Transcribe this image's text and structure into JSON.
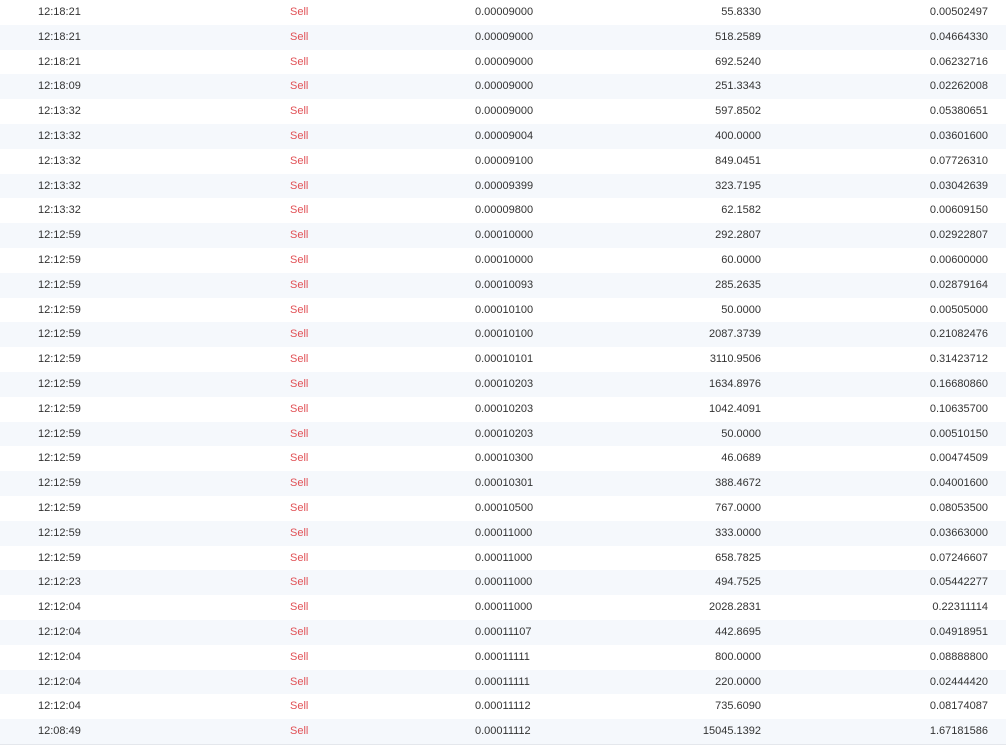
{
  "colors": {
    "sell": "#e15156",
    "text": "#333333",
    "row_alt_background": "#f5f8fc"
  },
  "trades": [
    {
      "time": "12:18:21",
      "side": "Sell",
      "price": "0.00009000",
      "amount": "55.8330",
      "total": "0.00502497"
    },
    {
      "time": "12:18:21",
      "side": "Sell",
      "price": "0.00009000",
      "amount": "518.2589",
      "total": "0.04664330"
    },
    {
      "time": "12:18:21",
      "side": "Sell",
      "price": "0.00009000",
      "amount": "692.5240",
      "total": "0.06232716"
    },
    {
      "time": "12:18:09",
      "side": "Sell",
      "price": "0.00009000",
      "amount": "251.3343",
      "total": "0.02262008"
    },
    {
      "time": "12:13:32",
      "side": "Sell",
      "price": "0.00009000",
      "amount": "597.8502",
      "total": "0.05380651"
    },
    {
      "time": "12:13:32",
      "side": "Sell",
      "price": "0.00009004",
      "amount": "400.0000",
      "total": "0.03601600"
    },
    {
      "time": "12:13:32",
      "side": "Sell",
      "price": "0.00009100",
      "amount": "849.0451",
      "total": "0.07726310"
    },
    {
      "time": "12:13:32",
      "side": "Sell",
      "price": "0.00009399",
      "amount": "323.7195",
      "total": "0.03042639"
    },
    {
      "time": "12:13:32",
      "side": "Sell",
      "price": "0.00009800",
      "amount": "62.1582",
      "total": "0.00609150"
    },
    {
      "time": "12:12:59",
      "side": "Sell",
      "price": "0.00010000",
      "amount": "292.2807",
      "total": "0.02922807"
    },
    {
      "time": "12:12:59",
      "side": "Sell",
      "price": "0.00010000",
      "amount": "60.0000",
      "total": "0.00600000"
    },
    {
      "time": "12:12:59",
      "side": "Sell",
      "price": "0.00010093",
      "amount": "285.2635",
      "total": "0.02879164"
    },
    {
      "time": "12:12:59",
      "side": "Sell",
      "price": "0.00010100",
      "amount": "50.0000",
      "total": "0.00505000"
    },
    {
      "time": "12:12:59",
      "side": "Sell",
      "price": "0.00010100",
      "amount": "2087.3739",
      "total": "0.21082476"
    },
    {
      "time": "12:12:59",
      "side": "Sell",
      "price": "0.00010101",
      "amount": "3110.9506",
      "total": "0.31423712"
    },
    {
      "time": "12:12:59",
      "side": "Sell",
      "price": "0.00010203",
      "amount": "1634.8976",
      "total": "0.16680860"
    },
    {
      "time": "12:12:59",
      "side": "Sell",
      "price": "0.00010203",
      "amount": "1042.4091",
      "total": "0.10635700"
    },
    {
      "time": "12:12:59",
      "side": "Sell",
      "price": "0.00010203",
      "amount": "50.0000",
      "total": "0.00510150"
    },
    {
      "time": "12:12:59",
      "side": "Sell",
      "price": "0.00010300",
      "amount": "46.0689",
      "total": "0.00474509"
    },
    {
      "time": "12:12:59",
      "side": "Sell",
      "price": "0.00010301",
      "amount": "388.4672",
      "total": "0.04001600"
    },
    {
      "time": "12:12:59",
      "side": "Sell",
      "price": "0.00010500",
      "amount": "767.0000",
      "total": "0.08053500"
    },
    {
      "time": "12:12:59",
      "side": "Sell",
      "price": "0.00011000",
      "amount": "333.0000",
      "total": "0.03663000"
    },
    {
      "time": "12:12:59",
      "side": "Sell",
      "price": "0.00011000",
      "amount": "658.7825",
      "total": "0.07246607"
    },
    {
      "time": "12:12:23",
      "side": "Sell",
      "price": "0.00011000",
      "amount": "494.7525",
      "total": "0.05442277"
    },
    {
      "time": "12:12:04",
      "side": "Sell",
      "price": "0.00011000",
      "amount": "2028.2831",
      "total": "0.22311114"
    },
    {
      "time": "12:12:04",
      "side": "Sell",
      "price": "0.00011107",
      "amount": "442.8695",
      "total": "0.04918951"
    },
    {
      "time": "12:12:04",
      "side": "Sell",
      "price": "0.00011111",
      "amount": "800.0000",
      "total": "0.08888800"
    },
    {
      "time": "12:12:04",
      "side": "Sell",
      "price": "0.00011111",
      "amount": "220.0000",
      "total": "0.02444420"
    },
    {
      "time": "12:12:04",
      "side": "Sell",
      "price": "0.00011112",
      "amount": "735.6090",
      "total": "0.08174087"
    },
    {
      "time": "12:08:49",
      "side": "Sell",
      "price": "0.00011112",
      "amount": "15045.1392",
      "total": "1.67181586"
    }
  ]
}
